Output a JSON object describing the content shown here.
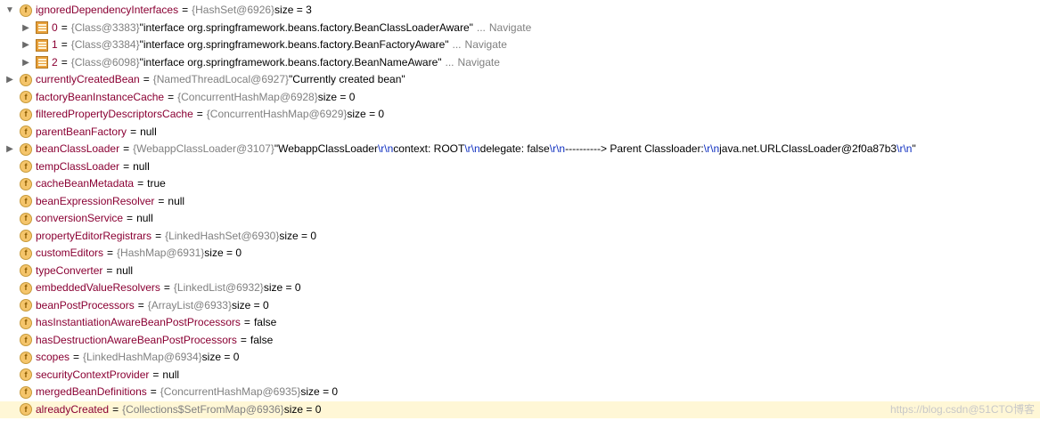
{
  "rows": [
    {
      "indent": 0,
      "arrow": "down",
      "icon": "f",
      "name": "ignoredDependencyInterfaces",
      "eq": " = ",
      "obj": "{HashSet@6926}",
      "tail": "  size = 3"
    },
    {
      "indent": 1,
      "arrow": "right",
      "icon": "idx",
      "name": "0",
      "eq": " = ",
      "obj": "{Class@3383}",
      "str": " \"interface org.springframework.beans.factory.BeanClassLoaderAware\"",
      "dots": "...",
      "nav": "Navigate"
    },
    {
      "indent": 1,
      "arrow": "right",
      "icon": "idx",
      "name": "1",
      "eq": " = ",
      "obj": "{Class@3384}",
      "str": " \"interface org.springframework.beans.factory.BeanFactoryAware\"",
      "dots": "...",
      "nav": "Navigate"
    },
    {
      "indent": 1,
      "arrow": "right",
      "icon": "idx",
      "name": "2",
      "eq": " = ",
      "obj": "{Class@6098}",
      "str": " \"interface org.springframework.beans.factory.BeanNameAware\"",
      "dots": "...",
      "nav": "Navigate"
    },
    {
      "indent": 0,
      "arrow": "right",
      "icon": "f",
      "name": "currentlyCreatedBean",
      "eq": " = ",
      "obj": "{NamedThreadLocal@6927}",
      "str": " \"Currently created bean\""
    },
    {
      "indent": 0,
      "arrow": "none",
      "icon": "f",
      "name": "factoryBeanInstanceCache",
      "eq": " = ",
      "obj": "{ConcurrentHashMap@6928}",
      "tail": "  size = 0"
    },
    {
      "indent": 0,
      "arrow": "none",
      "icon": "f",
      "name": "filteredPropertyDescriptorsCache",
      "eq": " = ",
      "obj": "{ConcurrentHashMap@6929}",
      "tail": "  size = 0"
    },
    {
      "indent": 0,
      "arrow": "none",
      "icon": "f",
      "name": "parentBeanFactory",
      "eq": " = ",
      "tail": "null"
    },
    {
      "indent": 0,
      "arrow": "right",
      "icon": "f",
      "name": "beanClassLoader",
      "eq": " = ",
      "obj": "{WebappClassLoader@3107}",
      "segs": [
        {
          "t": "str",
          "v": " \"WebappClassLoader"
        },
        {
          "t": "rn",
          "v": "\\r\\n"
        },
        {
          "t": "str",
          "v": "  context: ROOT"
        },
        {
          "t": "rn",
          "v": "\\r\\n"
        },
        {
          "t": "str",
          "v": "  delegate: false"
        },
        {
          "t": "rn",
          "v": "\\r\\n"
        },
        {
          "t": "str",
          "v": "----------> Parent Classloader:"
        },
        {
          "t": "rn",
          "v": "\\r\\n"
        },
        {
          "t": "str",
          "v": "java.net.URLClassLoader@2f0a87b3"
        },
        {
          "t": "rn",
          "v": "\\r\\n"
        },
        {
          "t": "str",
          "v": "\""
        }
      ]
    },
    {
      "indent": 0,
      "arrow": "none",
      "icon": "f",
      "name": "tempClassLoader",
      "eq": " = ",
      "tail": "null"
    },
    {
      "indent": 0,
      "arrow": "none",
      "icon": "f",
      "name": "cacheBeanMetadata",
      "eq": " = ",
      "tail": "true"
    },
    {
      "indent": 0,
      "arrow": "none",
      "icon": "f",
      "name": "beanExpressionResolver",
      "eq": " = ",
      "tail": "null"
    },
    {
      "indent": 0,
      "arrow": "none",
      "icon": "f",
      "name": "conversionService",
      "eq": " = ",
      "tail": "null"
    },
    {
      "indent": 0,
      "arrow": "none",
      "icon": "f",
      "name": "propertyEditorRegistrars",
      "eq": " = ",
      "obj": "{LinkedHashSet@6930}",
      "tail": "  size = 0"
    },
    {
      "indent": 0,
      "arrow": "none",
      "icon": "f",
      "name": "customEditors",
      "eq": " = ",
      "obj": "{HashMap@6931}",
      "tail": "  size = 0"
    },
    {
      "indent": 0,
      "arrow": "none",
      "icon": "f",
      "name": "typeConverter",
      "eq": " = ",
      "tail": "null"
    },
    {
      "indent": 0,
      "arrow": "none",
      "icon": "f",
      "name": "embeddedValueResolvers",
      "eq": " = ",
      "obj": "{LinkedList@6932}",
      "tail": "  size = 0"
    },
    {
      "indent": 0,
      "arrow": "none",
      "icon": "f",
      "name": "beanPostProcessors",
      "eq": " = ",
      "obj": "{ArrayList@6933}",
      "tail": "  size = 0"
    },
    {
      "indent": 0,
      "arrow": "none",
      "icon": "f",
      "name": "hasInstantiationAwareBeanPostProcessors",
      "eq": " = ",
      "tail": "false"
    },
    {
      "indent": 0,
      "arrow": "none",
      "icon": "f",
      "name": "hasDestructionAwareBeanPostProcessors",
      "eq": " = ",
      "tail": "false"
    },
    {
      "indent": 0,
      "arrow": "none",
      "icon": "f",
      "name": "scopes",
      "eq": " = ",
      "obj": "{LinkedHashMap@6934}",
      "tail": "  size = 0"
    },
    {
      "indent": 0,
      "arrow": "none",
      "icon": "f",
      "name": "securityContextProvider",
      "eq": " = ",
      "tail": "null"
    },
    {
      "indent": 0,
      "arrow": "none",
      "icon": "f",
      "name": "mergedBeanDefinitions",
      "eq": " = ",
      "obj": "{ConcurrentHashMap@6935}",
      "tail": "  size = 0"
    },
    {
      "indent": 0,
      "arrow": "none",
      "icon": "f",
      "name": "alreadyCreated",
      "eq": " = ",
      "obj": "{Collections$SetFromMap@6936}",
      "tail": "  size = 0",
      "highlight": true
    }
  ],
  "watermark": "https://blog.csdn@51CTO博客"
}
